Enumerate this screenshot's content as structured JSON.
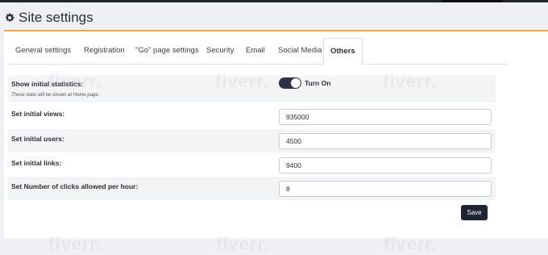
{
  "page": {
    "title": "Site settings",
    "icon": "gear-icon"
  },
  "tabs": [
    {
      "label": "General settings",
      "active": false
    },
    {
      "label": "Registration",
      "active": false
    },
    {
      "label": "\"Go\" page settings",
      "active": false
    },
    {
      "label": "Security",
      "active": false
    },
    {
      "label": "Email",
      "active": false
    },
    {
      "label": "Social Media",
      "active": false
    },
    {
      "label": "Others",
      "active": true
    }
  ],
  "settings": {
    "show_stats": {
      "label": "Show initial statistics:",
      "hint": "These stats will be shown at Home page.",
      "toggle_on": true,
      "toggle_label": "Turn On"
    },
    "views": {
      "label": "Set initial views:",
      "value": "935000"
    },
    "users": {
      "label": "Set initial users:",
      "value": "4500"
    },
    "links": {
      "label": "Set initial links:",
      "value": "9400"
    },
    "clicks": {
      "label": "Set Number of clicks allowed per hour:",
      "value": "8"
    }
  },
  "actions": {
    "save_label": "Save"
  },
  "watermark": "fiverr.",
  "colors": {
    "accent": "#f3a63a",
    "dark": "#1f2433",
    "toggle": "#2d3246"
  }
}
